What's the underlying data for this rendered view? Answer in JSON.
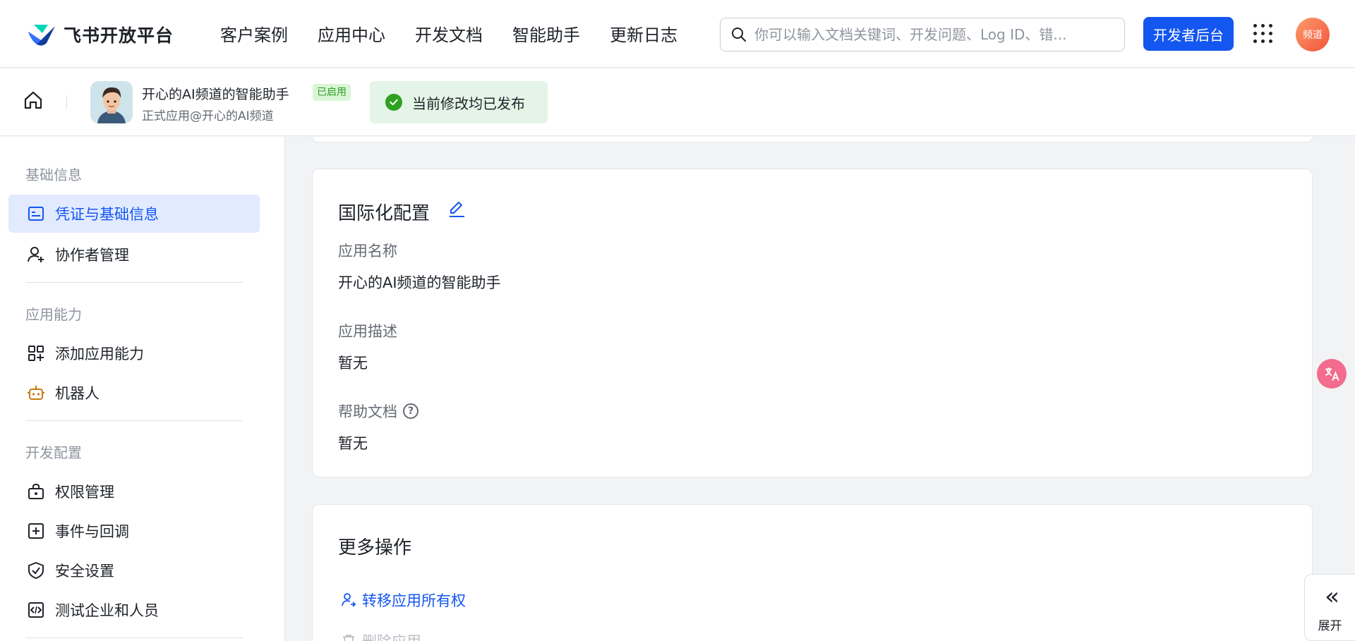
{
  "header": {
    "logo_text": "飞书开放平台",
    "nav": [
      "客户案例",
      "应用中心",
      "开发文档",
      "智能助手",
      "更新日志"
    ],
    "search_placeholder": "你可以输入文档关键词、开发问题、Log ID、错...",
    "dev_button": "开发者后台",
    "avatar_text": "频道",
    "brand_color": "#1456f0"
  },
  "subheader": {
    "app_name": "开心的AI频道的智能助手",
    "status_badge": "已启用",
    "app_subtitle": "正式应用@开心的AI频道",
    "publish_status": "当前修改均已发布"
  },
  "sidebar": {
    "groups": [
      {
        "title": "基础信息",
        "items": [
          {
            "label": "凭证与基础信息",
            "icon": "id-card-icon",
            "active": true
          },
          {
            "label": "协作者管理",
            "icon": "user-add-icon",
            "active": false
          }
        ]
      },
      {
        "title": "应用能力",
        "items": [
          {
            "label": "添加应用能力",
            "icon": "apps-add-icon",
            "active": false
          },
          {
            "label": "机器人",
            "icon": "robot-icon",
            "active": false
          }
        ]
      },
      {
        "title": "开发配置",
        "items": [
          {
            "label": "权限管理",
            "icon": "lock-icon",
            "active": false
          },
          {
            "label": "事件与回调",
            "icon": "event-plus-icon",
            "active": false
          },
          {
            "label": "安全设置",
            "icon": "shield-check-icon",
            "active": false
          },
          {
            "label": "测试企业和人员",
            "icon": "code-box-icon",
            "active": false
          }
        ]
      }
    ]
  },
  "i18n_card": {
    "title": "国际化配置",
    "fields": [
      {
        "label": "应用名称",
        "value": "开心的AI频道的智能助手"
      },
      {
        "label": "应用描述",
        "value": "暂无"
      },
      {
        "label": "帮助文档",
        "value": "暂无",
        "help_icon": "?"
      }
    ]
  },
  "more_card": {
    "title": "更多操作",
    "actions": [
      {
        "label": "转移应用所有权",
        "icon": "user-transfer-icon",
        "disabled": false
      },
      {
        "label": "删除应用",
        "icon": "trash-icon",
        "disabled": true
      }
    ]
  },
  "floating": {
    "expand_label": "展开",
    "expand_glyph": "«"
  }
}
